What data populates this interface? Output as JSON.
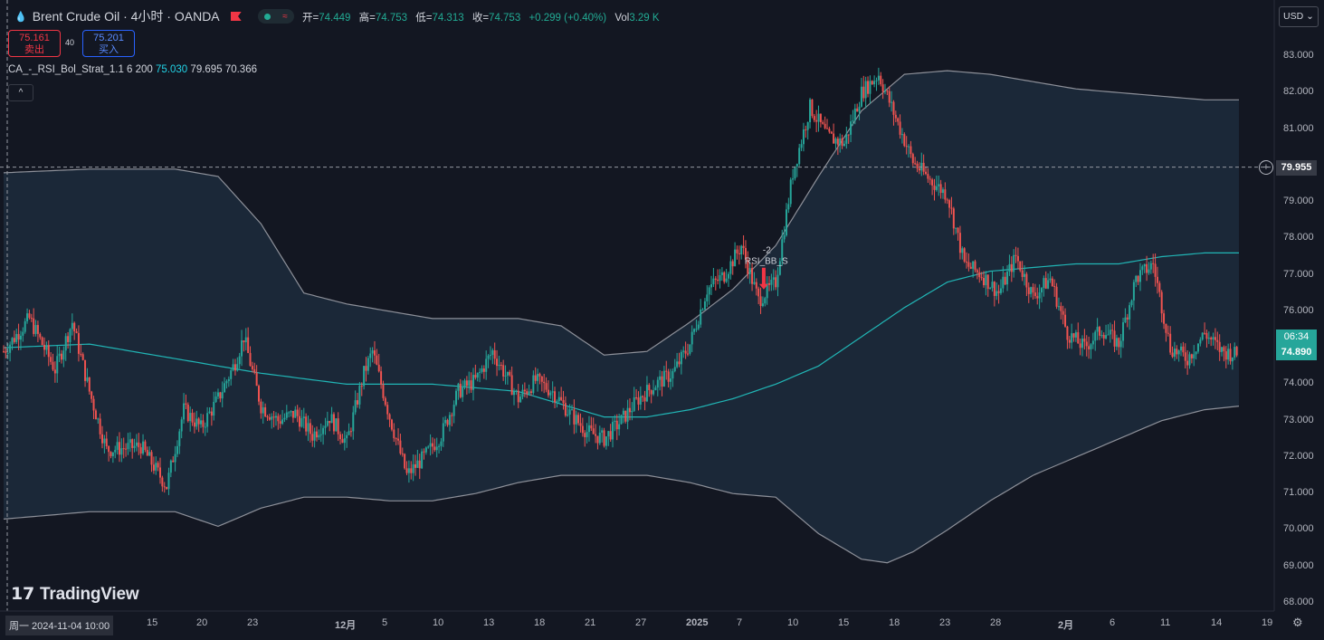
{
  "header": {
    "symbol_title": "Brent Crude Oil · 4小时 · OANDA",
    "ohlc": [
      {
        "label": "开=",
        "value": "74.449"
      },
      {
        "label": "高=",
        "value": "74.753"
      },
      {
        "label": "低=",
        "value": "74.313"
      },
      {
        "label": "收=",
        "value": "74.753"
      },
      {
        "label": "",
        "value": "+0.299 (+0.40%)"
      },
      {
        "label": "Vol",
        "value": "3.29 K"
      }
    ]
  },
  "trade": {
    "sell_price": "75.161",
    "sell_label": "卖出",
    "spread": "40",
    "buy_price": "75.201",
    "buy_label": "买入"
  },
  "indicator": {
    "name": "CA_-_RSI_Bol_Strat_1.1 6 200",
    "basis": "75.030",
    "upper": "79.695",
    "lower": "70.366"
  },
  "currency": "USD",
  "colors": {
    "up": "#26a69a",
    "down": "#ef5350",
    "basis": "#21b5b5",
    "band_fill": "#1b2838",
    "band_line": "#8d9099",
    "background": "#131722"
  },
  "chart_data": {
    "type": "candlestick",
    "instrument": "Brent Crude Oil",
    "timeframe": "4小时",
    "ylim": [
      67.8,
      84.2
    ],
    "y_ticks": [
      "83.000",
      "82.000",
      "81.000",
      "80.000",
      "79.000",
      "78.000",
      "77.000",
      "76.000",
      "75.000",
      "74.000",
      "73.000",
      "72.000",
      "71.000",
      "70.000",
      "69.000",
      "68.000"
    ],
    "x_labels": [
      "周一 2024-11-04  10:00",
      "15",
      "20",
      "23",
      "12月",
      "5",
      "10",
      "13",
      "18",
      "21",
      "27",
      "2025",
      "7",
      "10",
      "15",
      "18",
      "23",
      "28",
      "2月",
      "6",
      "11",
      "14",
      "19"
    ],
    "crosshair_price": "79.955",
    "current_price": "74.890",
    "countdown": "06:34",
    "signal": {
      "text": "-2",
      "label": "RSI_BB_S",
      "price": 76.6
    },
    "price_path": [
      [
        0,
        74.9
      ],
      [
        3,
        75.8
      ],
      [
        6,
        74.4
      ],
      [
        8,
        75.7
      ],
      [
        10,
        73.8
      ],
      [
        12,
        72.2
      ],
      [
        16,
        72.3
      ],
      [
        19,
        71.2
      ],
      [
        21,
        73.3
      ],
      [
        23,
        72.8
      ],
      [
        25,
        73.6
      ],
      [
        27,
        74.6
      ],
      [
        28,
        75.3
      ],
      [
        30,
        73.4
      ],
      [
        32,
        73.0
      ],
      [
        34,
        73.2
      ],
      [
        36,
        72.6
      ],
      [
        38,
        73.1
      ],
      [
        40,
        72.4
      ],
      [
        42,
        74.3
      ],
      [
        43,
        74.9
      ],
      [
        45,
        73.1
      ],
      [
        47,
        71.5
      ],
      [
        49,
        72.0
      ],
      [
        51,
        72.6
      ],
      [
        53,
        73.8
      ],
      [
        55,
        74.1
      ],
      [
        57,
        74.9
      ],
      [
        60,
        73.6
      ],
      [
        62,
        74.1
      ],
      [
        64,
        73.8
      ],
      [
        66,
        73.2
      ],
      [
        68,
        72.7
      ],
      [
        70,
        72.5
      ],
      [
        72,
        73.0
      ],
      [
        74,
        73.6
      ],
      [
        76,
        74.0
      ],
      [
        78,
        74.3
      ],
      [
        80,
        75.1
      ],
      [
        82,
        76.6
      ],
      [
        84,
        77.0
      ],
      [
        86,
        77.8
      ],
      [
        88,
        76.3
      ],
      [
        90,
        76.8
      ],
      [
        92,
        79.8
      ],
      [
        94,
        81.6
      ],
      [
        96,
        80.8
      ],
      [
        98,
        80.6
      ],
      [
        100,
        82.0
      ],
      [
        102,
        82.5
      ],
      [
        104,
        81.3
      ],
      [
        106,
        80.1
      ],
      [
        108,
        79.6
      ],
      [
        110,
        79.2
      ],
      [
        112,
        77.3
      ],
      [
        114,
        77.0
      ],
      [
        116,
        76.5
      ],
      [
        118,
        77.5
      ],
      [
        120,
        76.4
      ],
      [
        122,
        76.9
      ],
      [
        124,
        75.4
      ],
      [
        126,
        75.0
      ],
      [
        128,
        75.5
      ],
      [
        130,
        75.1
      ],
      [
        132,
        76.9
      ],
      [
        134,
        77.3
      ],
      [
        136,
        75.0
      ],
      [
        138,
        74.7
      ],
      [
        140,
        75.4
      ],
      [
        142,
        74.9
      ],
      [
        144,
        74.8
      ]
    ],
    "band_upper": [
      [
        0,
        79.8
      ],
      [
        10,
        79.9
      ],
      [
        20,
        79.9
      ],
      [
        25,
        79.7
      ],
      [
        30,
        78.4
      ],
      [
        35,
        76.5
      ],
      [
        40,
        76.2
      ],
      [
        45,
        76.0
      ],
      [
        50,
        75.8
      ],
      [
        55,
        75.8
      ],
      [
        60,
        75.8
      ],
      [
        65,
        75.6
      ],
      [
        70,
        74.8
      ],
      [
        75,
        74.9
      ],
      [
        80,
        75.7
      ],
      [
        85,
        76.6
      ],
      [
        90,
        77.8
      ],
      [
        95,
        79.7
      ],
      [
        100,
        81.5
      ],
      [
        105,
        82.5
      ],
      [
        110,
        82.6
      ],
      [
        115,
        82.5
      ],
      [
        120,
        82.3
      ],
      [
        125,
        82.1
      ],
      [
        130,
        82.0
      ],
      [
        135,
        81.9
      ],
      [
        140,
        81.8
      ],
      [
        144,
        81.8
      ]
    ],
    "band_lower": [
      [
        0,
        70.3
      ],
      [
        10,
        70.5
      ],
      [
        20,
        70.5
      ],
      [
        25,
        70.1
      ],
      [
        30,
        70.6
      ],
      [
        35,
        70.9
      ],
      [
        40,
        70.9
      ],
      [
        45,
        70.8
      ],
      [
        50,
        70.8
      ],
      [
        55,
        71.0
      ],
      [
        60,
        71.3
      ],
      [
        65,
        71.5
      ],
      [
        70,
        71.5
      ],
      [
        75,
        71.5
      ],
      [
        80,
        71.3
      ],
      [
        85,
        71.0
      ],
      [
        90,
        70.9
      ],
      [
        95,
        69.9
      ],
      [
        100,
        69.2
      ],
      [
        103,
        69.1
      ],
      [
        106,
        69.4
      ],
      [
        110,
        70.0
      ],
      [
        115,
        70.8
      ],
      [
        120,
        71.5
      ],
      [
        125,
        72.0
      ],
      [
        130,
        72.5
      ],
      [
        135,
        73.0
      ],
      [
        140,
        73.3
      ],
      [
        144,
        73.4
      ]
    ],
    "basis": [
      [
        0,
        75.0
      ],
      [
        10,
        75.1
      ],
      [
        20,
        74.7
      ],
      [
        30,
        74.3
      ],
      [
        40,
        74.0
      ],
      [
        50,
        74.0
      ],
      [
        60,
        73.8
      ],
      [
        70,
        73.1
      ],
      [
        75,
        73.1
      ],
      [
        80,
        73.3
      ],
      [
        85,
        73.6
      ],
      [
        90,
        74.0
      ],
      [
        95,
        74.5
      ],
      [
        100,
        75.3
      ],
      [
        105,
        76.1
      ],
      [
        110,
        76.8
      ],
      [
        115,
        77.1
      ],
      [
        120,
        77.2
      ],
      [
        125,
        77.3
      ],
      [
        130,
        77.3
      ],
      [
        135,
        77.5
      ],
      [
        140,
        77.6
      ],
      [
        144,
        77.6
      ]
    ]
  }
}
